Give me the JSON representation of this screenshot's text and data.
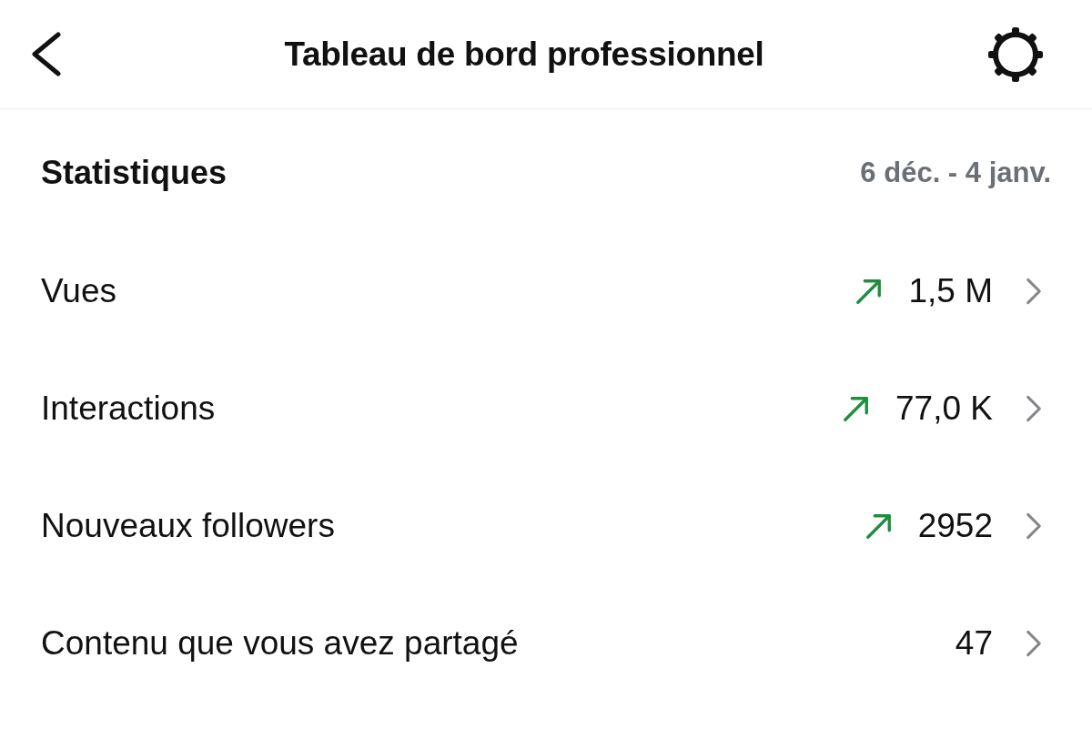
{
  "header": {
    "title": "Tableau de bord professionnel"
  },
  "statistics": {
    "title": "Statistiques",
    "date_range": "6 déc. - 4 janv."
  },
  "rows": [
    {
      "label": "Vues",
      "value": "1,5 M",
      "trending_up": true
    },
    {
      "label": "Interactions",
      "value": "77,0 K",
      "trending_up": true
    },
    {
      "label": "Nouveaux followers",
      "value": "2952",
      "trending_up": true
    },
    {
      "label": "Contenu que vous avez partagé",
      "value": "47",
      "trending_up": false
    }
  ]
}
